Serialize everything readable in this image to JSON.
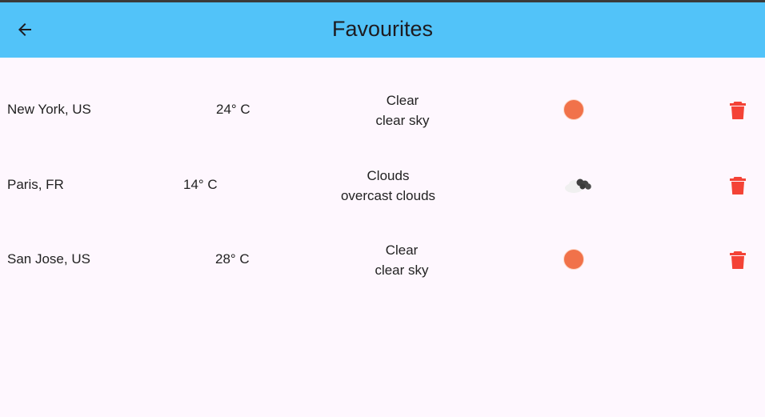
{
  "app_bar": {
    "title": "Favourites",
    "back_icon": "arrow-left-icon",
    "background": "#52c3f9"
  },
  "favourites": [
    {
      "city": "New York, US",
      "temperature": "24° C",
      "condition": "Clear",
      "description": "clear sky",
      "icon": "sun-icon",
      "icon_color": "#f1724a"
    },
    {
      "city": "Paris, FR",
      "temperature": "14° C",
      "condition": "Clouds",
      "description": "overcast clouds",
      "icon": "overcast-clouds-icon",
      "icon_color": "#444444"
    },
    {
      "city": "San Jose, US",
      "temperature": "28° C",
      "condition": "Clear",
      "description": "clear sky",
      "icon": "sun-icon",
      "icon_color": "#f1724a"
    }
  ],
  "delete_icon": "trash-icon",
  "delete_color": "#f44336"
}
